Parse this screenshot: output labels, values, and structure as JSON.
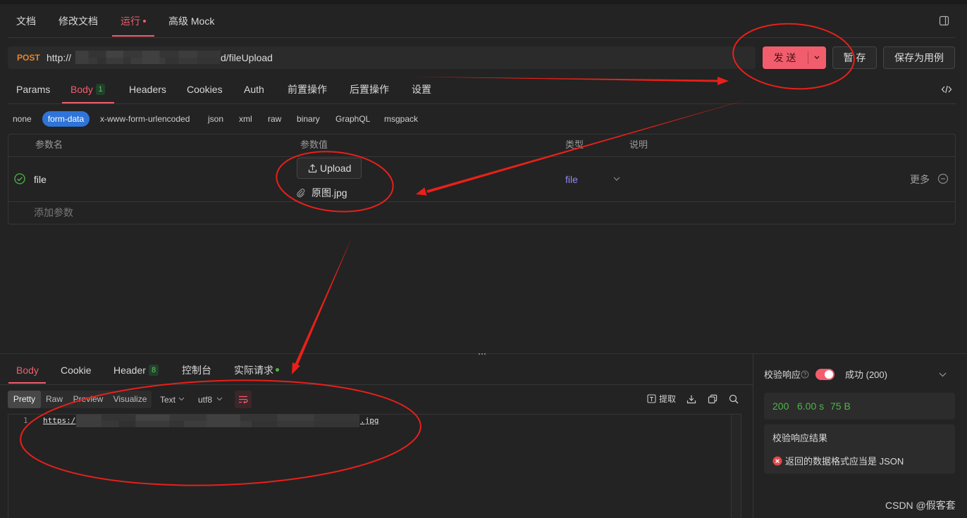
{
  "colors": {
    "accent": "#f25d6d",
    "method_post": "#e8852a",
    "success": "#4fb548",
    "type_file": "#8f88f2",
    "form_data_active": "#2f74d8",
    "annotation": "#e8201a"
  },
  "icons": {
    "panel_toggle": "sidebar-panel-icon",
    "code_view": "code-icon",
    "param_enabled": "check-circle-icon",
    "upload": "upload-icon",
    "attachment": "paperclip-icon",
    "remove_param": "minus-circle-icon",
    "help": "help-circle-icon",
    "error": "error-circle-icon",
    "extract": "extract-icon",
    "download": "download-icon",
    "copy": "copy-icon",
    "search": "search-icon",
    "wrap": "wrap-lines-icon"
  },
  "top_tabs": [
    {
      "label": "文档"
    },
    {
      "label": "修改文档"
    },
    {
      "label": "运行",
      "active": true
    },
    {
      "label": "高级 Mock"
    }
  ],
  "request": {
    "method": "POST",
    "url_prefix": "http://",
    "url_suffix": "d/fileUpload",
    "send_label": "发 送",
    "save_label": "暂 存",
    "save_as_case_label": "保存为用例"
  },
  "request_tabs": [
    {
      "label": "Params"
    },
    {
      "label": "Body",
      "badge": "1",
      "active": true
    },
    {
      "label": "Headers"
    },
    {
      "label": "Cookies"
    },
    {
      "label": "Auth"
    },
    {
      "label": "前置操作"
    },
    {
      "label": "后置操作"
    },
    {
      "label": "设置"
    }
  ],
  "body_types": [
    {
      "label": "none"
    },
    {
      "label": "form-data",
      "active": true
    },
    {
      "label": "x-www-form-urlencoded"
    },
    {
      "label": "json"
    },
    {
      "label": "xml"
    },
    {
      "label": "raw"
    },
    {
      "label": "binary"
    },
    {
      "label": "GraphQL"
    },
    {
      "label": "msgpack"
    }
  ],
  "params_table": {
    "headers": {
      "name": "参数名",
      "value": "参数值",
      "type": "类型",
      "description": "说明"
    },
    "rows": [
      {
        "enabled": true,
        "name": "file",
        "upload_label": "Upload",
        "file_name": "原图.jpg",
        "type": "file",
        "more_label": "更多"
      }
    ],
    "add_placeholder": "添加参数"
  },
  "response": {
    "tabs": [
      {
        "label": "Body",
        "active": true
      },
      {
        "label": "Cookie"
      },
      {
        "label": "Header",
        "badge": "8"
      },
      {
        "label": "控制台"
      },
      {
        "label": "实际请求"
      }
    ],
    "view_modes": [
      {
        "label": "Pretty",
        "active": true
      },
      {
        "label": "Raw"
      },
      {
        "label": "Preview"
      },
      {
        "label": "Visualize"
      }
    ],
    "format": "Text",
    "encoding": "utf8",
    "extract_label": "提取",
    "body_lines": [
      {
        "number": "1",
        "prefix": "https:/",
        "suffix": ".jpg"
      }
    ]
  },
  "validation": {
    "label": "校验响应",
    "enabled": true,
    "status_label": "成功 (200)",
    "stats": {
      "status_code": "200",
      "time": "6.00 s",
      "size": "75 B"
    },
    "result_title": "校验响应结果",
    "result_message": "返回的数据格式应当是 JSON"
  },
  "watermark": "CSDN @假客套"
}
